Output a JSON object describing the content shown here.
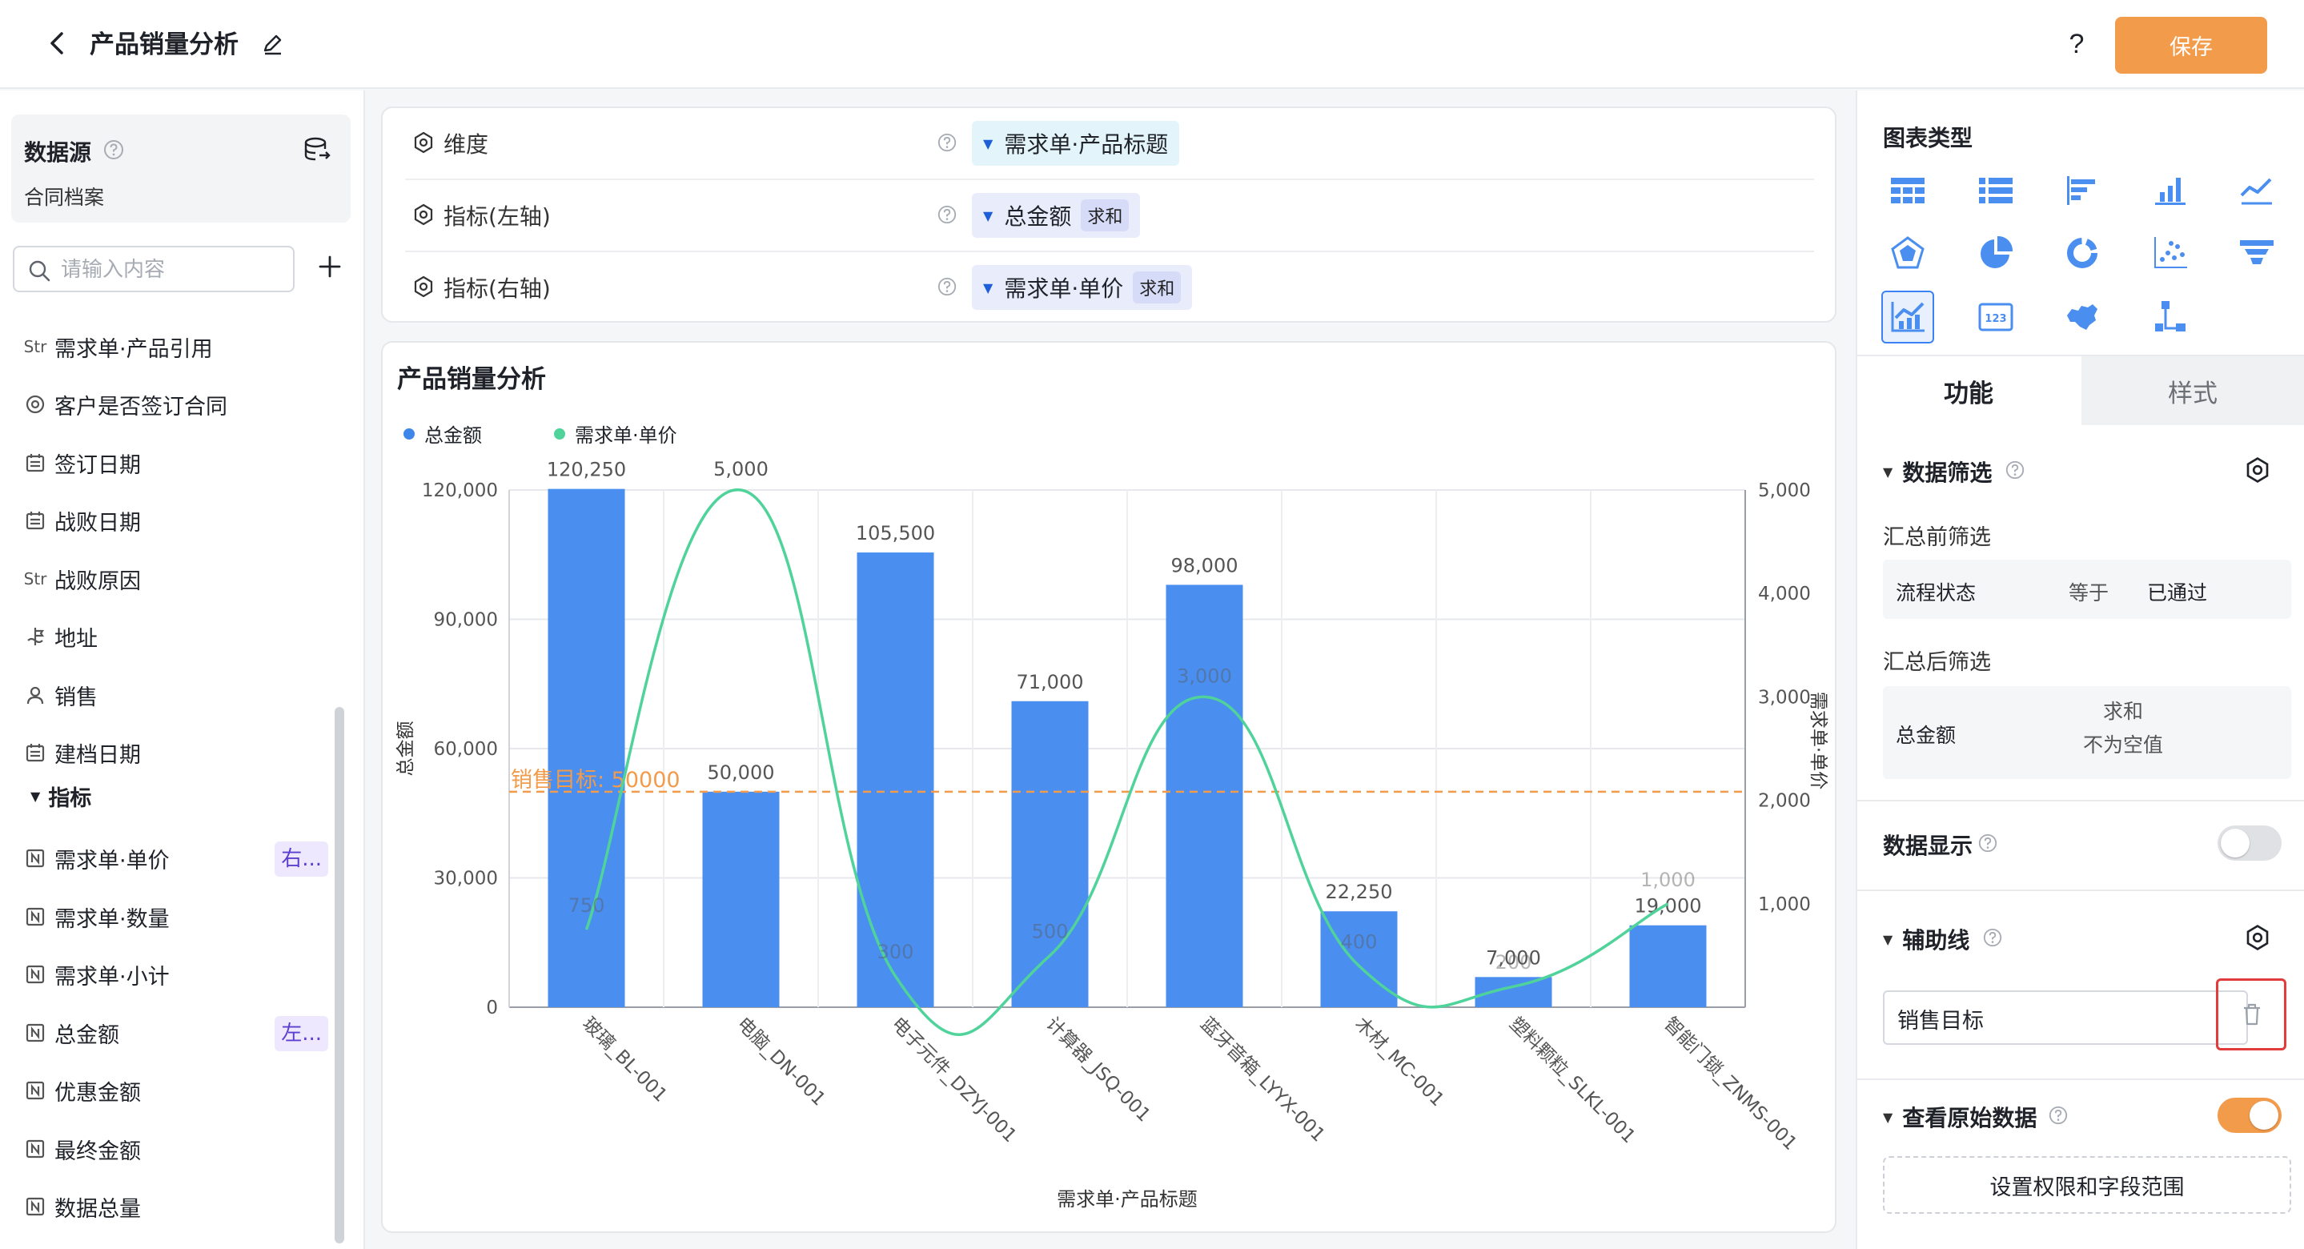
{
  "header": {
    "title": "产品销量分析",
    "save_label": "保存",
    "help_glyph": "?"
  },
  "sidebar": {
    "datasource_title": "数据源",
    "datasource_name": "合同档案",
    "search_placeholder": "请输入内容",
    "fields": [
      {
        "type_label": "Str",
        "label": "需求单·产品引用"
      },
      {
        "type_label": "",
        "label": "客户是否签订合同"
      },
      {
        "type_label": "",
        "label": "签订日期"
      },
      {
        "type_label": "",
        "label": "战败日期"
      },
      {
        "type_label": "Str",
        "label": "战败原因"
      },
      {
        "type_label": "",
        "label": "地址"
      },
      {
        "type_label": "",
        "label": "销售"
      },
      {
        "type_label": "",
        "label": "建档日期"
      }
    ],
    "metrics_title": "指标",
    "metrics": [
      {
        "label": "需求单·单价",
        "tag": "右..."
      },
      {
        "label": "需求单·数量",
        "tag": ""
      },
      {
        "label": "需求单·小计",
        "tag": ""
      },
      {
        "label": "总金额",
        "tag": "左..."
      },
      {
        "label": "优惠金额",
        "tag": ""
      },
      {
        "label": "最终金额",
        "tag": ""
      },
      {
        "label": "数据总量",
        "tag": ""
      }
    ]
  },
  "config": {
    "dimension_label": "维度",
    "dimension_value": "需求单·产品标题",
    "left_axis_label": "指标(左轴)",
    "left_axis_value": "总金额",
    "left_axis_agg": "求和",
    "right_axis_label": "指标(右轴)",
    "right_axis_value": "需求单·单价",
    "right_axis_agg": "求和"
  },
  "chart_data": {
    "type": "bar",
    "title": "产品销量分析",
    "categories": [
      "玻璃_BL-001",
      "电脑_DN-001",
      "电子元件_DZYJ-001",
      "计算器_JSQ-001",
      "蓝牙音箱_LYYX-001",
      "木材_MC-001",
      "塑料颗粒_SLKL-001",
      "智能门锁_ZNMS-001"
    ],
    "series": [
      {
        "name": "总金额",
        "type": "bar",
        "axis": "left",
        "color": "#4a8ef0",
        "values": [
          120250,
          50000,
          105500,
          71000,
          98000,
          22250,
          7000,
          19000
        ],
        "labels": [
          "120,250",
          "50,000",
          "105,500",
          "71,000",
          "98,000",
          "22,250",
          "7,000",
          "19,000"
        ]
      },
      {
        "name": "需求单·单价",
        "type": "line",
        "smooth": true,
        "axis": "right",
        "color": "#4fd39a",
        "values": [
          750,
          5000,
          300,
          500,
          3000,
          400,
          200,
          1000
        ],
        "labels": [
          "750",
          "5,000",
          "300",
          "500",
          "3,000",
          "400",
          "200",
          "1,000"
        ]
      }
    ],
    "xlabel": "需求单·产品标题",
    "ylabel": "总金额",
    "y2label": "需求单·单价",
    "ylim": [
      0,
      120000
    ],
    "y2lim": [
      0,
      5000
    ],
    "yticks": [
      "0",
      "30,000",
      "60,000",
      "90,000",
      "120,000"
    ],
    "y2ticks": [
      "1,000",
      "2,000",
      "3,000",
      "4,000",
      "5,000"
    ],
    "reference_line": {
      "label": "销售目标: 50000",
      "value": 50000,
      "axis": "left",
      "color": "#f29b4b"
    },
    "legend_position": "top-left",
    "grid": true
  },
  "rpanel": {
    "chart_type_title": "图表类型",
    "chart_types": [
      "table-icon",
      "list-icon",
      "hbar-icon",
      "bar-icon",
      "line-icon",
      "radar-icon",
      "pie-icon",
      "donut-icon",
      "scatter-icon",
      "funnel-icon",
      "combo-icon",
      "kpi-icon",
      "map-icon",
      "tree-icon"
    ],
    "selected_chart_type": "combo-icon",
    "tab_func": "功能",
    "tab_style": "样式",
    "filter_title": "数据筛选",
    "pre_filter_title": "汇总前筛选",
    "pre_filter": {
      "field": "流程状态",
      "op": "等于",
      "value": "已通过"
    },
    "post_filter_title": "汇总后筛选",
    "post_filter": {
      "field": "总金额",
      "agg": "求和",
      "cond": "不为空值"
    },
    "data_display_title": "数据显示",
    "data_display_on": false,
    "aux_line_title": "辅助线",
    "aux_line_value": "销售目标",
    "raw_data_title": "查看原始数据",
    "raw_data_on": true,
    "perm_button": "设置权限和字段范围"
  }
}
